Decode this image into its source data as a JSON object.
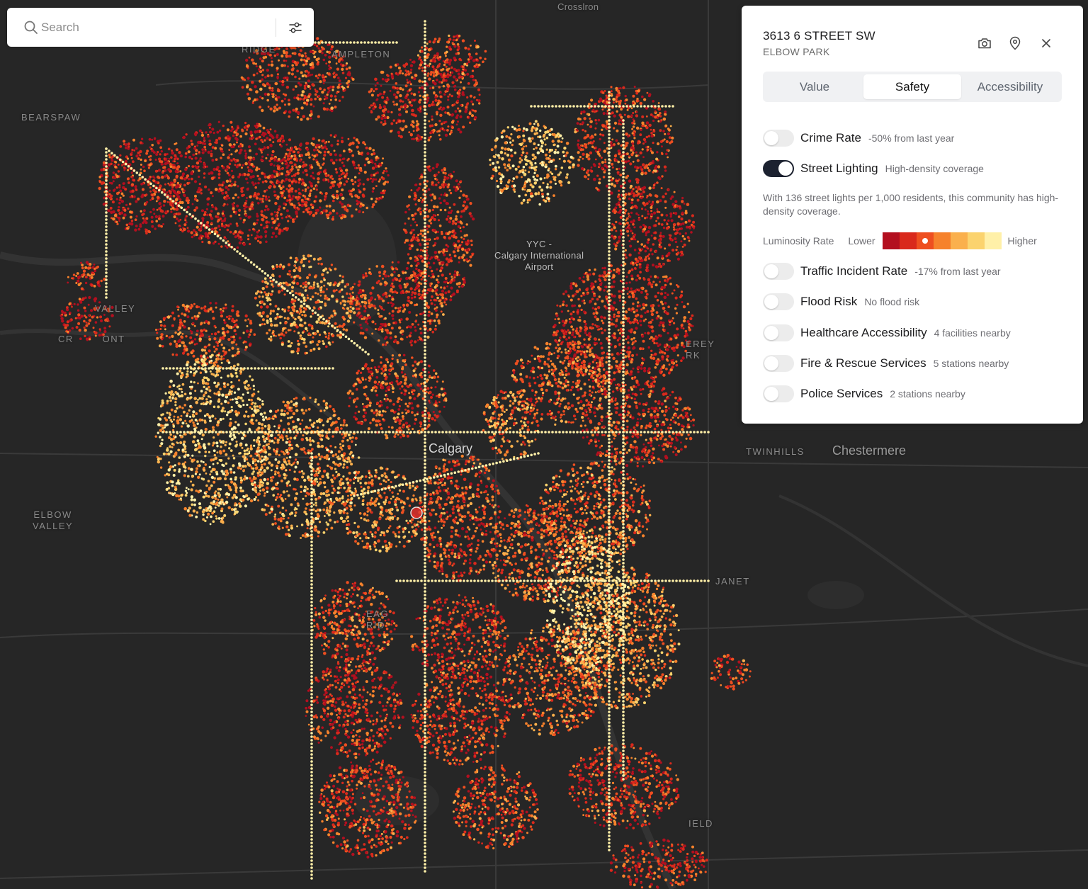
{
  "search": {
    "placeholder": "Search"
  },
  "map": {
    "labels": [
      {
        "id": "crosslron",
        "text": "Crosslron"
      },
      {
        "id": "ridge",
        "text": "RIDGE"
      },
      {
        "id": "ampleton",
        "text": "AMPLETON"
      },
      {
        "id": "bearspaw",
        "text": "BEARSPAW"
      },
      {
        "id": "valley",
        "text": "VALLEY"
      },
      {
        "id": "cr-ont",
        "text": "CR        ONT"
      },
      {
        "id": "elbow-valley",
        "text": "ELBOW\nVALLEY"
      },
      {
        "id": "airport",
        "text": "YYC -\nCalgary International\nAirport"
      },
      {
        "id": "calgary",
        "text": "Calgary"
      },
      {
        "id": "twinhills",
        "text": "TWINHILLS"
      },
      {
        "id": "chestermere",
        "text": "Chestermere"
      },
      {
        "id": "janet",
        "text": "JANET"
      },
      {
        "id": "erey-rk",
        "text": "EREY\nRK"
      },
      {
        "id": "eag-rid",
        "text": "EAG\nRID"
      },
      {
        "id": "ield",
        "text": "IELD"
      }
    ],
    "colors": {
      "background": "#262626",
      "road": "#3a3a3a",
      "water": "#333333",
      "heat": [
        "#b30f1f",
        "#d9291c",
        "#ee4f20",
        "#f6822c",
        "#fab04d",
        "#fbd36e",
        "#fff0a8"
      ]
    }
  },
  "panel": {
    "address": "3613 6 STREET SW",
    "community": "ELBOW PARK",
    "icons": {
      "camera": "camera-icon",
      "location": "map-pin-icon",
      "close": "close-icon"
    },
    "tabs": [
      {
        "label": "Value",
        "active": false
      },
      {
        "label": "Safety",
        "active": true
      },
      {
        "label": "Accessibility",
        "active": false
      }
    ],
    "layers": [
      {
        "label": "Crime Rate",
        "sub": "-50% from last year",
        "on": false
      },
      {
        "label": "Street Lighting",
        "sub": "High-density coverage",
        "on": true
      },
      {
        "label": "Traffic Incident Rate",
        "sub": "-17% from last year",
        "on": false
      },
      {
        "label": "Flood Risk",
        "sub": "No flood risk",
        "on": false
      },
      {
        "label": "Healthcare Accessibility",
        "sub": "4 facilities nearby",
        "on": false
      },
      {
        "label": "Fire & Rescue Services",
        "sub": "5 stations nearby",
        "on": false
      },
      {
        "label": "Police Services",
        "sub": "2 stations nearby",
        "on": false
      }
    ],
    "description": "With 136 street lights per 1,000 residents, this community has high-density coverage.",
    "luminosity": {
      "title": "Luminosity Rate",
      "lower": "Lower",
      "higher": "Higher",
      "colors": [
        "#b30f1f",
        "#d9291c",
        "#ee4f20",
        "#f6822c",
        "#fab04d",
        "#fbd36e",
        "#fff0a8"
      ],
      "selected_index": 2
    }
  }
}
